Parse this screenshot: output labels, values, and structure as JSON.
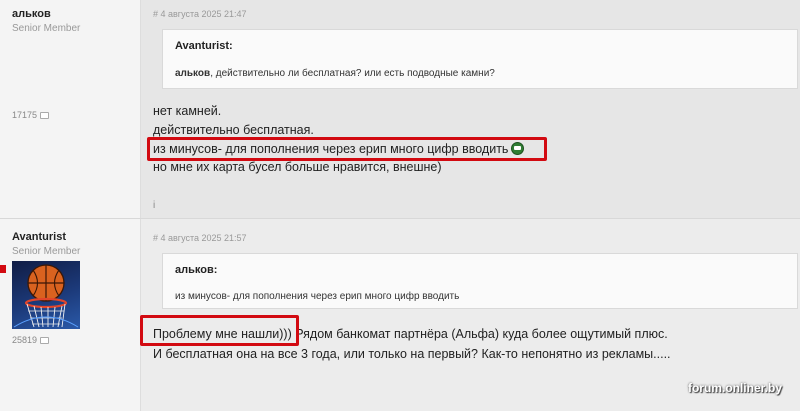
{
  "posts": [
    {
      "author": "альков",
      "role": "Senior Member",
      "post_count": "17175",
      "meta": "# 4 августа 2025 21:47",
      "quote": {
        "author": "Avanturist:",
        "mention": "альков",
        "text": ", действительно ли бесплатная? или есть подводные камни?"
      },
      "lines": [
        "нет камней.",
        "действительно бесплатная.",
        "из минусов- для пополнения через ерип много цифр вводить",
        "но мне их карта бусел больше нравится, внешне)"
      ],
      "emoji": "money-mouth-emoji",
      "footer_mark": "i"
    },
    {
      "author": "Avanturist",
      "role": "Senior Member",
      "post_count": "25819",
      "meta": "# 4 августа 2025 21:57",
      "quote": {
        "author": "альков:",
        "text": "из минусов- для пополнения через ерип много цифр вводить"
      },
      "lines": [
        "Проблему мне нашли))) Рядом банкомат партнёра (Альфа) куда более ощутимый плюс.",
        "И бесплатная она на все 3 года, или только на первый? Как-то непонятно из рекламы....."
      ],
      "avatar": "basketball-hoop-avatar"
    }
  ],
  "watermark": "forum.onliner.by",
  "highlight_color": "#d20a11"
}
